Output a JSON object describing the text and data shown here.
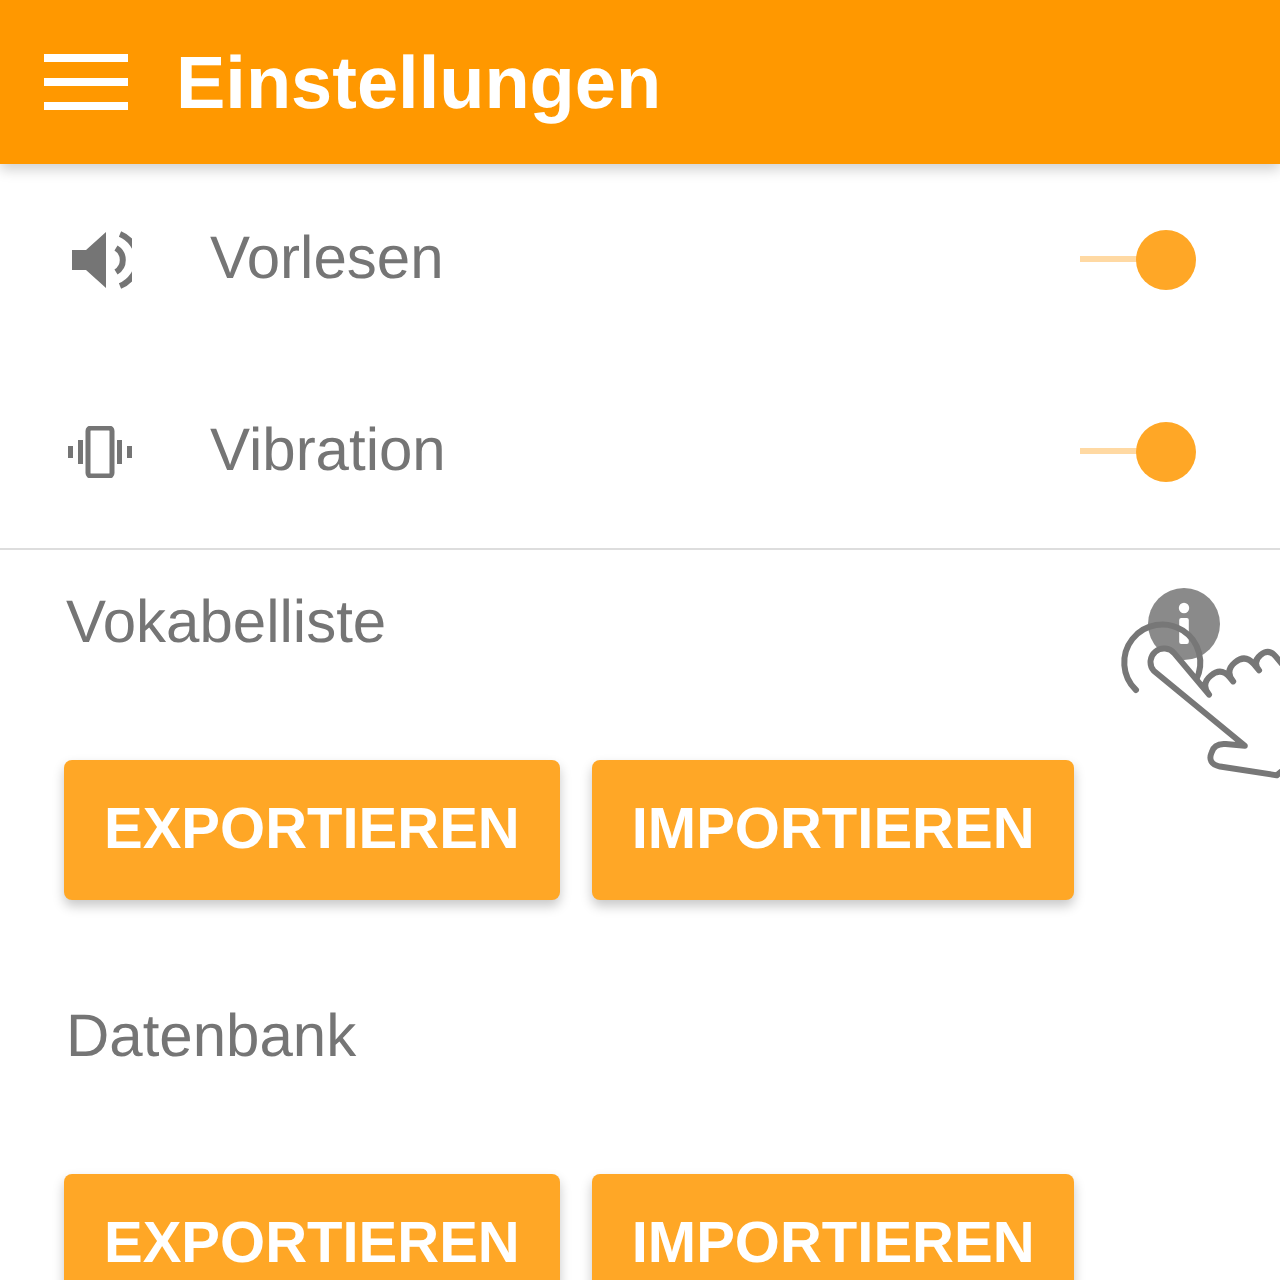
{
  "header": {
    "title": "Einstellungen"
  },
  "toggles": [
    {
      "kind": "speech",
      "label": "Vorlesen",
      "on": true
    },
    {
      "kind": "vibration",
      "label": "Vibration",
      "on": true
    }
  ],
  "sections": [
    {
      "title": "Vokabelliste",
      "info": true,
      "tap_hint": true,
      "buttons": [
        "EXPORTIEREN",
        "IMPORTIEREN"
      ]
    },
    {
      "title": "Datenbank",
      "info": false,
      "tap_hint": false,
      "buttons": [
        "EXPORTIEREN",
        "IMPORTIEREN"
      ]
    }
  ]
}
